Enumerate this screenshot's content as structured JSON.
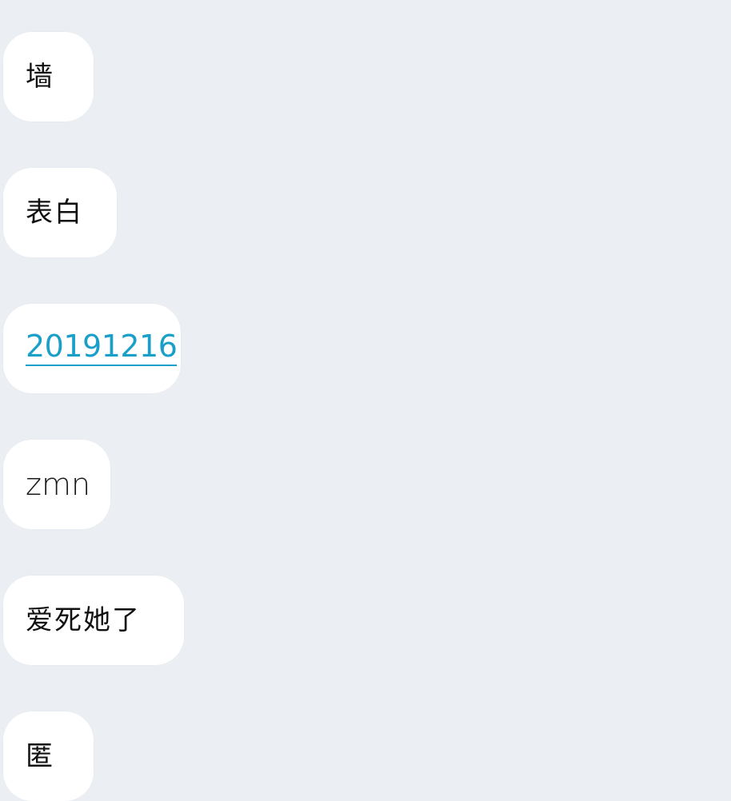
{
  "messages": [
    {
      "text": "墙",
      "kind": "text"
    },
    {
      "text": "表白",
      "kind": "text"
    },
    {
      "text": "20191216",
      "kind": "link"
    },
    {
      "text": "zmn",
      "kind": "latin"
    },
    {
      "text": "爱死她了",
      "kind": "text"
    },
    {
      "text": "匿",
      "kind": "text"
    }
  ],
  "colors": {
    "background": "#ebeff3",
    "bubble": "#ffffff",
    "link": "#1aa0c8",
    "text": "#111111"
  }
}
